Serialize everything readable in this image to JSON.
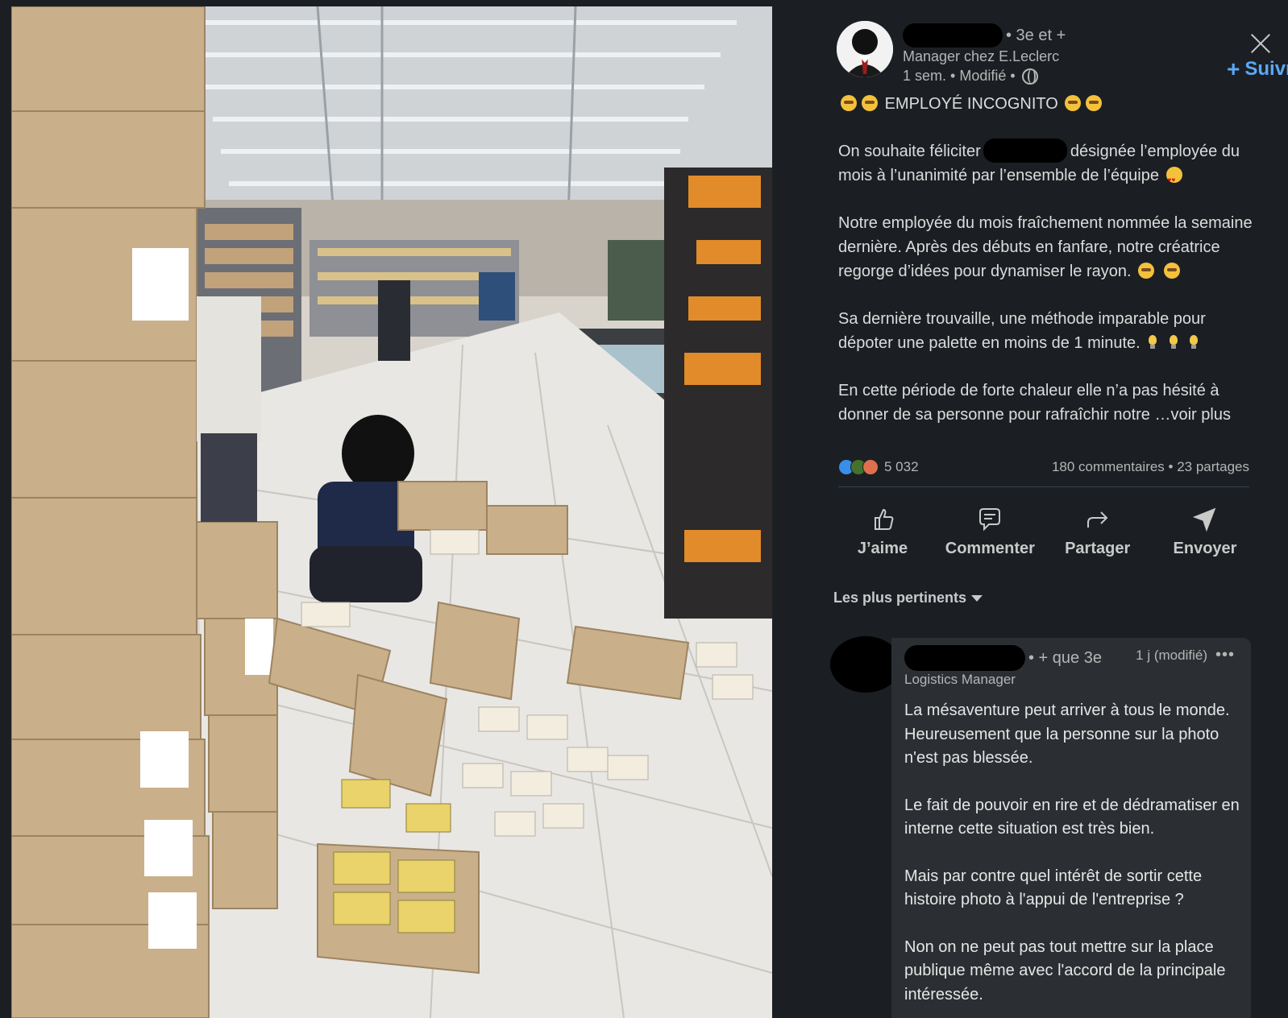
{
  "post": {
    "author": {
      "degree": "• 3e et +",
      "headline": "Manager chez E.Leclerc",
      "meta": "1 sem. • Modifié •"
    },
    "follow_label": "Suivre",
    "follow_plus": "+",
    "paragraphs": {
      "title": "EMPLOYÉ INCOGNITO",
      "p1_before": "On souhaite féliciter",
      "p1_after": "désignée l’employée du mois à l’unanimité par l’ensemble de l’équipe",
      "p2": "Notre employée du mois fraîchement nommée la semaine dernière. Après des débuts en fanfare, notre créatrice regorge d’idées pour dynamiser le rayon.",
      "p3": "Sa dernière trouvaille, une méthode imparable pour dépoter une palette en moins de 1 minute.",
      "p4": "En cette période de forte chaleur elle n’a pas hésité à donner de sa personne pour rafraîchir notre",
      "see_more": "…voir plus"
    },
    "stats": {
      "reactions_count": "5 032",
      "comments_shares": "180 commentaires • 23 partages"
    },
    "actions": {
      "like": "J’aime",
      "comment": "Commenter",
      "share": "Partager",
      "send": "Envoyer"
    },
    "sort_label": "Les plus pertinents"
  },
  "comment": {
    "degree": "• + que 3e",
    "time": "1 j (modifié)",
    "more": "•••",
    "headline": "Logistics Manager",
    "paragraphs": [
      "La mésaventure peut arriver à tous le monde. Heureusement que la personne sur la photo n'est pas blessée.",
      "Le fait de pouvoir en rire et de dédramatiser en interne cette situation est très bien.",
      "Mais par contre quel intérêt de sortir cette histoire photo à l'appui de l'entreprise ?",
      "Non on ne peut pas tout mettre sur la place publique même avec l'accord de la principale intéressée."
    ]
  },
  "colors": {
    "background": "#1b1f23",
    "link_blue": "#5aa8f5",
    "comment_bg": "#2b2f33"
  }
}
